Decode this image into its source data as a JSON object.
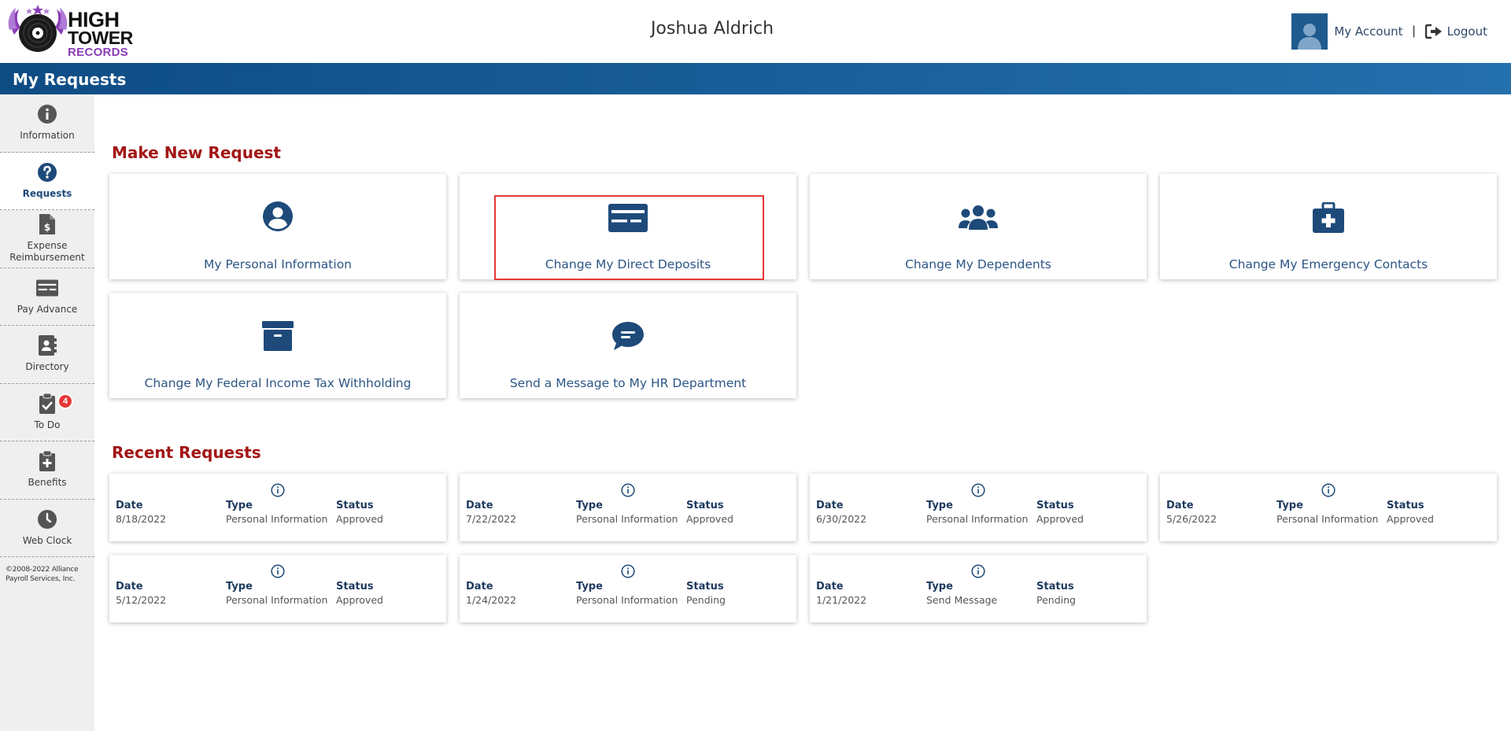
{
  "header": {
    "logo": {
      "line1": "HIGH",
      "line2": "TOWER",
      "line3": "RECORDS"
    },
    "user_name": "Joshua Aldrich",
    "my_account": "My Account",
    "separator": "|",
    "logout": "Logout"
  },
  "page_title": "My Requests",
  "sidebar": {
    "items": [
      {
        "label": "Information",
        "icon": "info-circle-icon"
      },
      {
        "label": "Requests",
        "icon": "question-circle-icon",
        "active": true
      },
      {
        "label": "Expense Reimbursement",
        "icon": "receipt-dollar-icon"
      },
      {
        "label": "Pay Advance",
        "icon": "money-check-icon"
      },
      {
        "label": "Directory",
        "icon": "address-book-icon"
      },
      {
        "label": "To Do",
        "icon": "clipboard-check-icon",
        "badge": "4"
      },
      {
        "label": "Benefits",
        "icon": "clipboard-plus-icon"
      },
      {
        "label": "Web Clock",
        "icon": "clock-icon"
      }
    ],
    "copyright": "©2008-2022 Alliance Payroll Services, Inc."
  },
  "make_new_request": {
    "title": "Make New Request",
    "cards": [
      {
        "label": "My Personal Information",
        "icon": "user-circle-icon"
      },
      {
        "label": "Change My Direct Deposits",
        "icon": "money-check-icon",
        "highlighted": true
      },
      {
        "label": "Change My Dependents",
        "icon": "users-icon"
      },
      {
        "label": "Change My Emergency Contacts",
        "icon": "first-aid-kit-icon"
      },
      {
        "label": "Change My Federal Income Tax Withholding",
        "icon": "archive-box-icon"
      },
      {
        "label": "Send a Message to My HR Department",
        "icon": "message-bubble-icon"
      }
    ]
  },
  "recent_requests": {
    "title": "Recent Requests",
    "column_headers": {
      "date": "Date",
      "type": "Type",
      "status": "Status"
    },
    "items": [
      {
        "date": "8/18/2022",
        "type": "Personal Information",
        "status": "Approved"
      },
      {
        "date": "7/22/2022",
        "type": "Personal Information",
        "status": "Approved"
      },
      {
        "date": "6/30/2022",
        "type": "Personal Information",
        "status": "Approved"
      },
      {
        "date": "5/26/2022",
        "type": "Personal Information",
        "status": "Approved"
      },
      {
        "date": "5/12/2022",
        "type": "Personal Information",
        "status": "Approved"
      },
      {
        "date": "1/24/2022",
        "type": "Personal Information",
        "status": "Pending"
      },
      {
        "date": "1/21/2022",
        "type": "Send Message",
        "status": "Pending"
      }
    ]
  },
  "colors": {
    "accent_blue": "#1e5a8e",
    "section_red": "#a31515",
    "highlight_red": "#e53935",
    "badge_red": "#e53935",
    "logo_purple": "#8a3db7"
  }
}
